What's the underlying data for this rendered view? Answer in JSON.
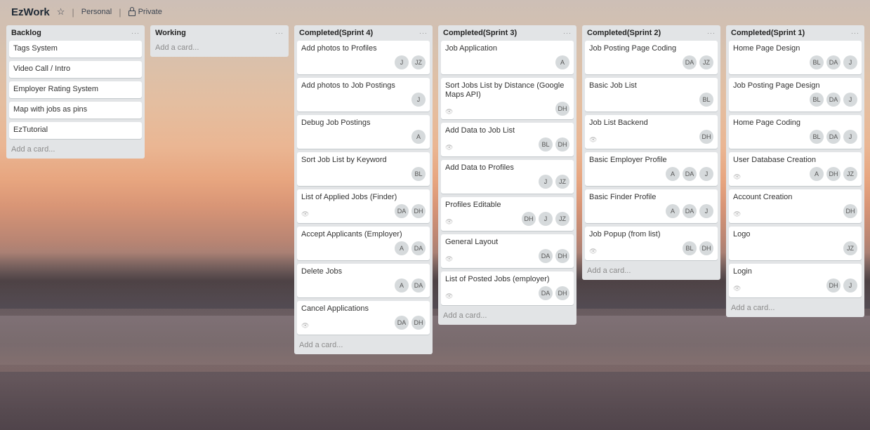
{
  "board": {
    "title": "EzWork",
    "star_icon": "star-icon",
    "workspace": "Personal",
    "visibility": "Private"
  },
  "add_card_label": "Add a card...",
  "lists": [
    {
      "title": "Backlog",
      "cards": [
        {
          "title": "Tags System",
          "avatars": [],
          "eye": false
        },
        {
          "title": "Video Call / Intro",
          "avatars": [],
          "eye": false
        },
        {
          "title": "Employer Rating System",
          "avatars": [],
          "eye": false
        },
        {
          "title": "Map with jobs as pins",
          "avatars": [],
          "eye": false
        },
        {
          "title": "EzTutorial",
          "avatars": [],
          "eye": false
        }
      ]
    },
    {
      "title": "Working",
      "cards": []
    },
    {
      "title": "Completed(Sprint 4)",
      "cards": [
        {
          "title": "Add photos to Profiles",
          "avatars": [
            "J",
            "JZ"
          ],
          "eye": false
        },
        {
          "title": "Add photos to Job Postings",
          "avatars": [
            "J"
          ],
          "eye": false
        },
        {
          "title": "Debug Job Postings",
          "avatars": [
            "A"
          ],
          "eye": false
        },
        {
          "title": "Sort Job List by Keyword",
          "avatars": [
            "BL"
          ],
          "eye": false
        },
        {
          "title": "List of Applied Jobs (Finder)",
          "avatars": [
            "DA",
            "DH"
          ],
          "eye": true
        },
        {
          "title": "Accept Applicants (Employer)",
          "avatars": [
            "A",
            "DA"
          ],
          "eye": false
        },
        {
          "title": "Delete Jobs",
          "avatars": [
            "A",
            "DA"
          ],
          "eye": false
        },
        {
          "title": "Cancel Applications",
          "avatars": [
            "DA",
            "DH"
          ],
          "eye": true
        }
      ]
    },
    {
      "title": "Completed(Sprint 3)",
      "cards": [
        {
          "title": "Job Application",
          "avatars": [
            "A"
          ],
          "eye": false
        },
        {
          "title": "Sort Jobs List by Distance (Google Maps API)",
          "avatars": [
            "DH"
          ],
          "eye": true
        },
        {
          "title": "Add Data to Job List",
          "avatars": [
            "BL",
            "DH"
          ],
          "eye": true
        },
        {
          "title": "Add Data to Profiles",
          "avatars": [
            "J",
            "JZ"
          ],
          "eye": false
        },
        {
          "title": "Profiles Editable",
          "avatars": [
            "DH",
            "J",
            "JZ"
          ],
          "eye": true
        },
        {
          "title": "General Layout",
          "avatars": [
            "DA",
            "DH"
          ],
          "eye": true
        },
        {
          "title": "List of Posted Jobs (employer)",
          "avatars": [
            "DA",
            "DH"
          ],
          "eye": true
        }
      ]
    },
    {
      "title": "Completed(Sprint 2)",
      "cards": [
        {
          "title": "Job Posting Page Coding",
          "avatars": [
            "DA",
            "JZ"
          ],
          "eye": false
        },
        {
          "title": "Basic Job List",
          "avatars": [
            "BL"
          ],
          "eye": false
        },
        {
          "title": "Job List Backend",
          "avatars": [
            "DH"
          ],
          "eye": true
        },
        {
          "title": "Basic Employer Profile",
          "avatars": [
            "A",
            "DA",
            "J"
          ],
          "eye": false
        },
        {
          "title": "Basic Finder Profile",
          "avatars": [
            "A",
            "DA",
            "J"
          ],
          "eye": false
        },
        {
          "title": "Job Popup (from list)",
          "avatars": [
            "BL",
            "DH"
          ],
          "eye": true
        }
      ]
    },
    {
      "title": "Completed(Sprint 1)",
      "cards": [
        {
          "title": "Home Page Design",
          "avatars": [
            "BL",
            "DA",
            "J"
          ],
          "eye": false
        },
        {
          "title": "Job Posting Page Design",
          "avatars": [
            "BL",
            "DA",
            "J"
          ],
          "eye": false
        },
        {
          "title": "Home Page Coding",
          "avatars": [
            "BL",
            "DA",
            "J"
          ],
          "eye": false
        },
        {
          "title": "User Database Creation",
          "avatars": [
            "A",
            "DH",
            "JZ"
          ],
          "eye": true
        },
        {
          "title": "Account Creation",
          "avatars": [
            "DH"
          ],
          "eye": true
        },
        {
          "title": "Logo",
          "avatars": [
            "JZ"
          ],
          "eye": false
        },
        {
          "title": "Login",
          "avatars": [
            "DH",
            "J"
          ],
          "eye": true
        }
      ]
    }
  ]
}
